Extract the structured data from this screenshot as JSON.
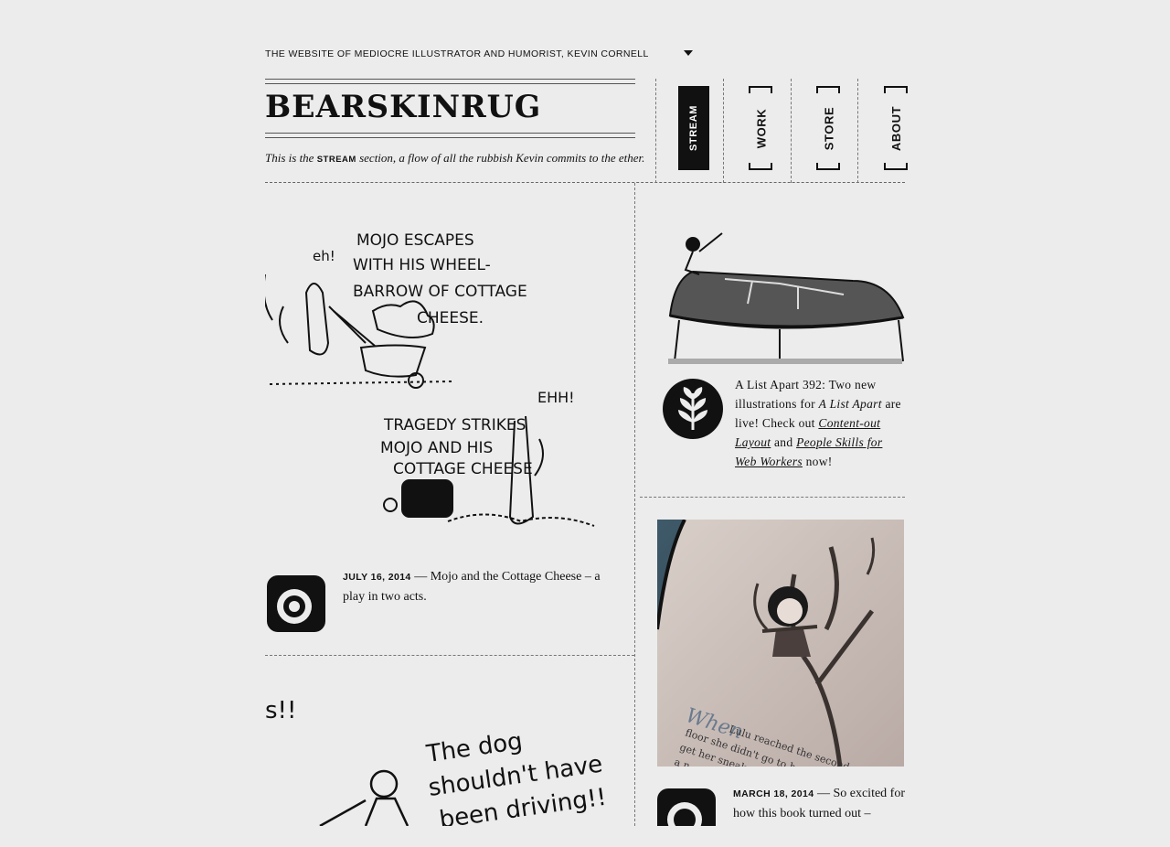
{
  "header": {
    "tagline": "THE WEBSITE OF MEDIOCRE ILLUSTRATOR AND HUMORIST, KEVIN CORNELL",
    "logo": "BEARSKINRUG",
    "intro_pre": "This is the ",
    "intro_section": "STREAM",
    "intro_post": " section, a flow of all the rubbish Kevin commits to the ether."
  },
  "nav": {
    "items": [
      {
        "label": "STREAM",
        "active": true
      },
      {
        "label": "WORK"
      },
      {
        "label": "STORE"
      },
      {
        "label": "ABOUT"
      }
    ]
  },
  "posts": {
    "mojo": {
      "comic_top": [
        "MOJO ESCAPES",
        "WITH HIS WHEEL-",
        "BARROW OF COTTAGE",
        "CHEESE."
      ],
      "comic_eh": "eh!",
      "comic_bottom": [
        "TRAGEDY STRIKES",
        "MOJO AND HIS",
        "COTTAGE CHEESE"
      ],
      "comic_ehh": "EHH!",
      "date": "JULY 16, 2014",
      "sep": " — ",
      "text": "Mojo and the Cottage Cheese – a play in two acts."
    },
    "alist": {
      "line1": "A List Apart 392: Two new illustrations for ",
      "italic": "A List Apart",
      "line2": " are live! Check out ",
      "link1": "Content-out Layout",
      "and": " and ",
      "link2": "People Skills for Web Workers",
      "end": " now!"
    },
    "dog": {
      "comic_a": "s!!",
      "comic_b": [
        "The dog",
        "shouldn't have",
        "been driving!!"
      ]
    },
    "book": {
      "photo_when": "When",
      "photo_line1": "Lulu reached the second",
      "photo_line2": "floor she didn't go to her b",
      "photo_line3": "get her sneake",
      "photo_line4": "a n",
      "date": "MARCH 18, 2014",
      "sep": " — ",
      "text": "So excited for how this book turned out –"
    }
  }
}
